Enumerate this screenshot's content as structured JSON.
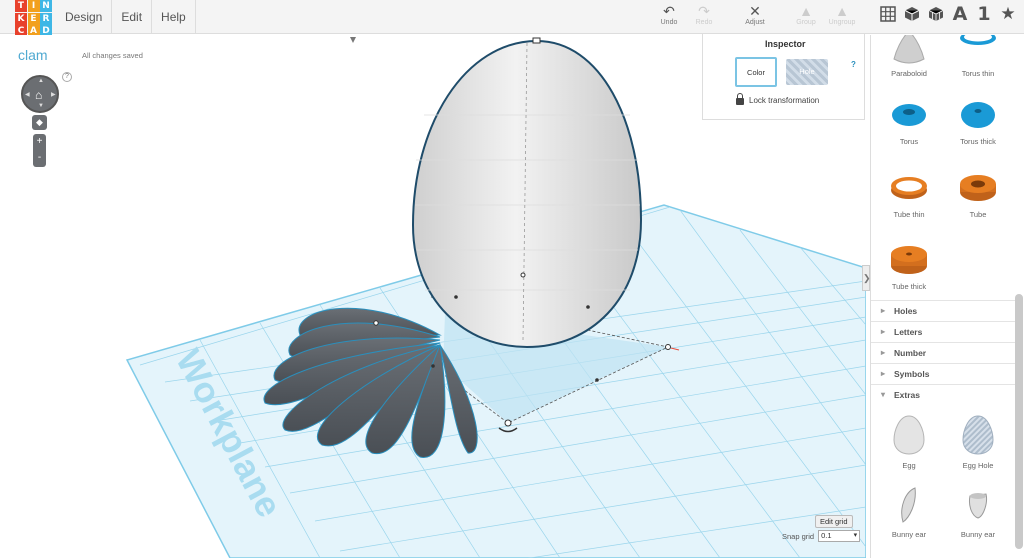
{
  "app": {
    "logo_letters": [
      "T",
      "I",
      "N",
      "K",
      "E",
      "R",
      "C",
      "A",
      "D"
    ],
    "logo_colors": [
      "#e8412c",
      "#f2a01e",
      "#3eb7e6",
      "#e8412c",
      "#f2a01e",
      "#3eb7e6",
      "#e8412c",
      "#f2a01e",
      "#3eb7e6"
    ],
    "menu": [
      "Design",
      "Edit",
      "Help"
    ]
  },
  "toolbar": {
    "undo_label": "Undo",
    "redo_label": "Redo",
    "adjust_label": "Adjust",
    "group_label": "Group",
    "ungroup_label": "Ungroup",
    "undo_icon": "undo-arrow-icon",
    "redo_icon": "redo-arrow-icon",
    "adjust_icon": "adjust-icon",
    "group_icon": "group-icon",
    "ungroup_icon": "ungroup-icon"
  },
  "views": {
    "grid_icon": "grid-view-icon",
    "box_icon": "box-view-icon",
    "bricks_icon": "bricks-view-icon",
    "text_label": "A",
    "number_label": "1",
    "star_icon": "star-icon"
  },
  "document": {
    "title": "clam",
    "status": "All changes saved"
  },
  "inspector": {
    "title": "Inspector",
    "help": "?",
    "color_label": "Color",
    "hole_label": "Hole",
    "lock_label": "Lock transformation"
  },
  "viewport": {
    "help": "?",
    "workplane_label": "Workplane",
    "edit_grid_label": "Edit grid",
    "snap_label": "Snap grid",
    "snap_value": "0.1",
    "zoom_in": "+",
    "zoom_out": "-",
    "home_icon": "home-icon",
    "collapse_glyph": "❯"
  },
  "shapes": [
    {
      "label": "Paraboloid",
      "icon": "paraboloid-icon",
      "color": "#bdbdbd"
    },
    {
      "label": "Torus thin",
      "icon": "torus-thin-icon",
      "color": "#1a9ad6"
    },
    {
      "label": "Torus",
      "icon": "torus-icon",
      "color": "#1a9ad6"
    },
    {
      "label": "Torus thick",
      "icon": "torus-thick-icon",
      "color": "#1a9ad6"
    },
    {
      "label": "Tube thin",
      "icon": "tube-thin-icon",
      "color": "#e67e22"
    },
    {
      "label": "Tube",
      "icon": "tube-icon",
      "color": "#e67e22"
    },
    {
      "label": "Tube thick",
      "icon": "tube-thick-icon",
      "color": "#e67e22"
    }
  ],
  "categories": [
    {
      "label": "Holes",
      "open": false
    },
    {
      "label": "Letters",
      "open": false
    },
    {
      "label": "Number",
      "open": false
    },
    {
      "label": "Symbols",
      "open": false
    },
    {
      "label": "Extras",
      "open": true
    }
  ],
  "extras": [
    {
      "label": "Egg",
      "icon": "egg-icon"
    },
    {
      "label": "Egg Hole",
      "icon": "egg-hole-icon"
    },
    {
      "label": "Bunny ear",
      "icon": "bunny-ear-icon"
    },
    {
      "label": "Bunny ear",
      "icon": "bunny-ear-2-icon"
    }
  ],
  "colors": {
    "accent": "#4fa9d1",
    "grid_line": "#8fd0ea",
    "grid_fill": "#dff2fb",
    "object_dark": "#575c62",
    "egg": "#e6e6e6"
  }
}
